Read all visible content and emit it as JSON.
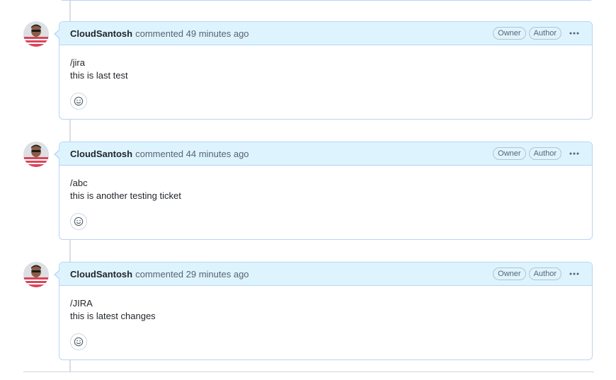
{
  "comments": [
    {
      "author": "CloudSantosh",
      "meta": "commented 49 minutes ago",
      "labels": [
        "Owner",
        "Author"
      ],
      "body_line1": "/jira",
      "body_line2": "this is last test"
    },
    {
      "author": "CloudSantosh",
      "meta": "commented 44 minutes ago",
      "labels": [
        "Owner",
        "Author"
      ],
      "body_line1": "/abc",
      "body_line2": "this is another testing ticket"
    },
    {
      "author": "CloudSantosh",
      "meta": "commented 29 minutes ago",
      "labels": [
        "Owner",
        "Author"
      ],
      "body_line1": "/JIRA",
      "body_line2": "this is latest changes"
    }
  ],
  "icons": {
    "menu": "kebab-horizontal-icon",
    "reaction": "smiley-icon"
  },
  "colors": {
    "header_bg": "#ddf4ff",
    "border": "#b6d6f5",
    "muted_text": "#59636e"
  }
}
